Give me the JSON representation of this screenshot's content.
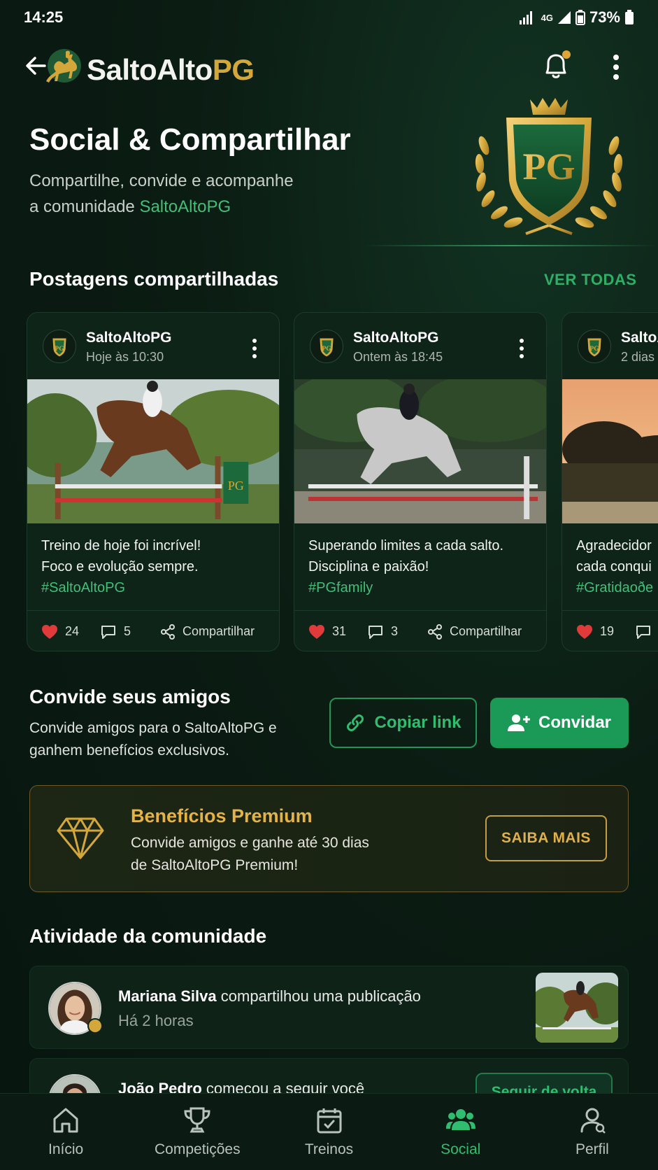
{
  "status_bar": {
    "time": "14:25",
    "network": "4G",
    "battery": "73%"
  },
  "header": {
    "logo_part1": "SaltoAlto",
    "logo_part2": "PG"
  },
  "hero": {
    "title": "Social & Compartilhar",
    "subtitle_line1": "Compartilhe, convide e acompanhe",
    "subtitle_prefix": "a comunidade ",
    "subtitle_highlight": "SaltoAltoPG",
    "crest_text": "PG"
  },
  "shared_posts": {
    "title": "Postagens compartilhadas",
    "see_all": "VER TODAS",
    "items": [
      {
        "author": "SaltoAltoPG",
        "time": "Hoje às 10:30",
        "line1": "Treino de hoje foi incrível!",
        "line2": "Foco e evolução sempre.",
        "hashtag": "#SaltoAltoPG",
        "likes": "24",
        "comments": "5",
        "share": "Compartilhar"
      },
      {
        "author": "SaltoAltoPG",
        "time": "Ontem às 18:45",
        "line1": "Superando limites a cada salto.",
        "line2": "Disciplina e paixão!",
        "hashtag": "#PGfamily",
        "likes": "31",
        "comments": "3",
        "share": "Compartilhar"
      },
      {
        "author": "SaltoA",
        "time": "2 dias",
        "line1": "Agradecidor",
        "line2": "cada conqui",
        "hashtag": "#Gratidaoðe",
        "likes": "19"
      }
    ]
  },
  "invite": {
    "title": "Convide seus amigos",
    "desc_line1": "Convide amigos para o SaltoAltoPG e",
    "desc_line2": "ganhem benefícios exclusivos.",
    "copy_label": "Copiar link",
    "invite_label": "Convidar"
  },
  "premium": {
    "title": "Benefícios Premium",
    "desc_line1": "Convide amigos e ganhe até 30 dias",
    "desc_line2": "de SaltoAltoPG Premium!",
    "cta": "SAIBA MAIS"
  },
  "activity": {
    "title": "Atividade da comunidade",
    "items": [
      {
        "name": "Mariana Silva",
        "action": " compartilhou uma publicação",
        "time": "Há 2 horas"
      },
      {
        "name": "João Pedro",
        "action": " começou a seguir você",
        "button": "Seguir de volta"
      }
    ]
  },
  "nav": {
    "items": [
      {
        "label": "Início",
        "icon": "home-icon"
      },
      {
        "label": "Competições",
        "icon": "trophy-icon"
      },
      {
        "label": "Treinos",
        "icon": "calendar-icon"
      },
      {
        "label": "Social",
        "icon": "people-icon",
        "active": true
      },
      {
        "label": "Perfil",
        "icon": "profile-icon"
      }
    ]
  },
  "colors": {
    "accent_green": "#2fbd70",
    "gold": "#d4a73a",
    "background": "#0b1c13"
  }
}
